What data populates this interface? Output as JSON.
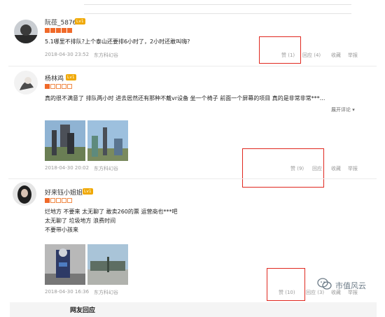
{
  "reviews": [
    {
      "username": "阮莅_5876",
      "level": "Lv1",
      "rating": 5,
      "text_lines": [
        "5.1哪里不排队?上个泰山还要排6小时了，2小时还敢叫嗨?"
      ],
      "date": "2018-04-30 23:52",
      "source": "东方科幻谷",
      "actions": {
        "like": "赞 (1)",
        "reply": "回应 (4)",
        "favorite": "收藏",
        "report": "举报"
      }
    },
    {
      "username": "杨林鸡",
      "level": "Lv1",
      "rating": 1,
      "text_lines": [
        "真的很不满意了 排队两小时 进去居然还有那种不戴vr设备 坐一个椅子 前面一个屏幕的项目 真的是非常非常***..."
      ],
      "expand": "展开评论 ▾",
      "date": "2018-04-30 20:02",
      "source": "东方科幻谷",
      "actions": {
        "like": "赞 (9)",
        "reply": "回应",
        "favorite": "收藏",
        "report": "举报"
      }
    },
    {
      "username": "好来钰小姐姐",
      "level": "Lv1",
      "rating": 1,
      "text_lines": [
        "烂地方 不要来 太无聊了 敢卖260的票 运营商也***吧",
        "太无聊了 垃圾地方 浪费时间",
        "不要带小孩来"
      ],
      "date": "2018-04-30 16:36",
      "source": "东方科幻谷",
      "actions": {
        "like": "赞 (10)",
        "reply": "回应 (3)",
        "favorite": "收藏",
        "report": "举报"
      }
    }
  ],
  "footer": {
    "title": "网友回应"
  },
  "watermark": {
    "text": "市值风云",
    "icon": "wechat-icon"
  },
  "colors": {
    "highlight": "#e0281f",
    "star": "#f06a2a",
    "level_badge": "#f0a800"
  }
}
